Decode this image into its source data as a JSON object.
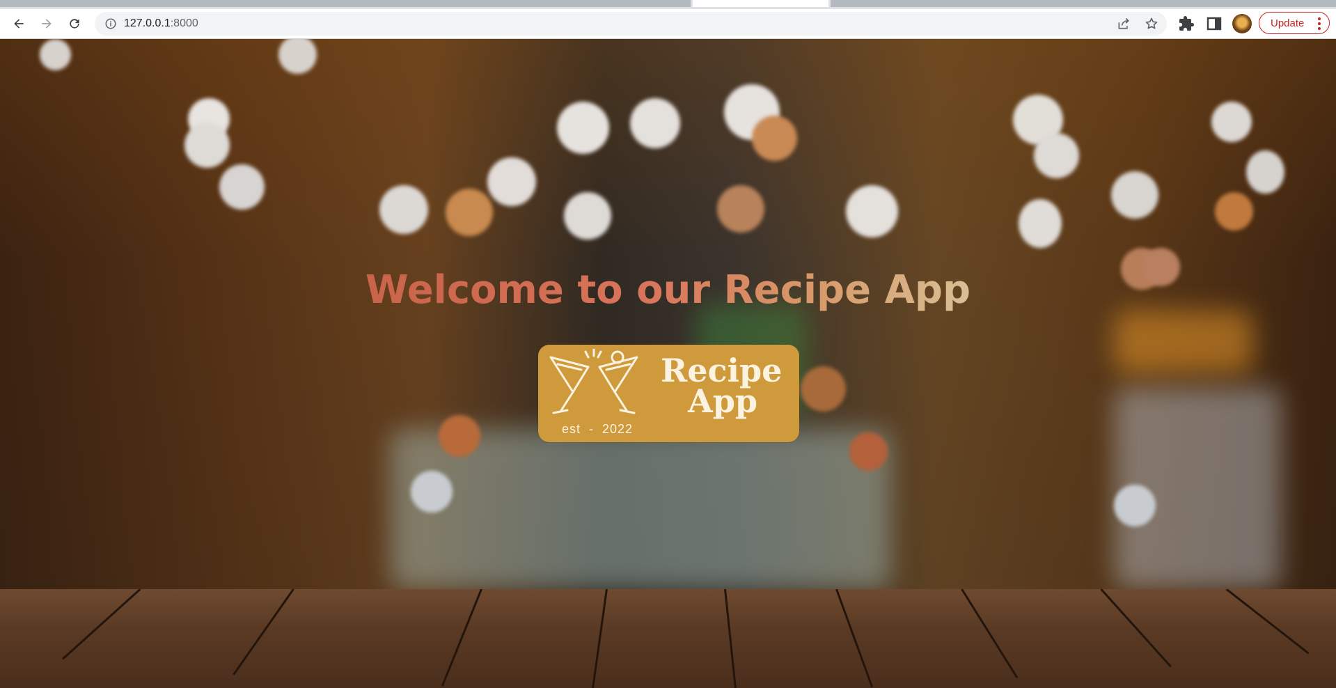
{
  "browser": {
    "url_host": "127.0.0.1",
    "url_port": ":8000",
    "update_label": "Update",
    "icons": [
      "back-arrow-icon",
      "forward-arrow-icon",
      "reload-icon",
      "site-info-icon",
      "share-icon",
      "bookmark-star-icon",
      "extensions-puzzle-icon",
      "side-panel-icon",
      "profile-avatar",
      "kebab-menu-icon"
    ]
  },
  "page": {
    "headline": "Welcome to our Recipe App",
    "logo": {
      "title_line1": "Recipe",
      "title_line2": "App",
      "tagline": "est  -  2022",
      "badge_color": "#cf9a3c",
      "text_color": "#fbf3e0"
    },
    "headline_gradient": [
      "#c8644a",
      "#d8c095"
    ]
  }
}
